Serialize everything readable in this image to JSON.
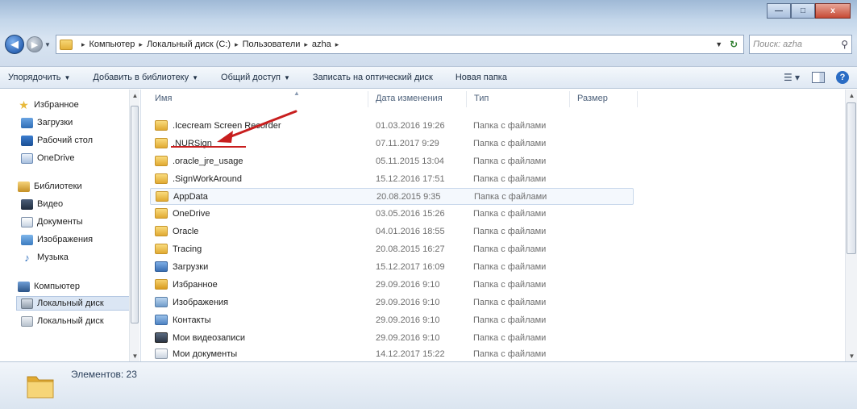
{
  "window": {
    "buttons": {
      "minimize": "—",
      "maximize": "□",
      "close": "x"
    }
  },
  "address_bar": {
    "crumbs": [
      "Компьютер",
      "Локальный диск (C:)",
      "Пользователи",
      "azha"
    ],
    "separator": "▸"
  },
  "search": {
    "placeholder": "Поиск: azha"
  },
  "toolbar": {
    "organize": "Упорядочить",
    "add_to_library": "Добавить в библиотеку",
    "share": "Общий доступ",
    "burn": "Записать на оптический диск",
    "new_folder": "Новая папка"
  },
  "navigation": {
    "favorites": "Избранное",
    "downloads": "Загрузки",
    "desktop": "Рабочий стол",
    "onedrive": "OneDrive",
    "libraries": "Библиотеки",
    "video": "Видео",
    "documents": "Документы",
    "images": "Изображения",
    "music": "Музыка",
    "computer": "Компьютер",
    "local_disk_1": "Локальный диск",
    "local_disk_2": "Локальный диск"
  },
  "columns": {
    "name": "Имя",
    "date": "Дата изменения",
    "type": "Тип",
    "size": "Размер"
  },
  "files": [
    {
      "name": ".Icecream Screen Recorder",
      "date": "01.03.2016 19:26",
      "type": "Папка с файлами",
      "icon": "folder-icon"
    },
    {
      "name": ".NURSign",
      "date": "07.11.2017 9:29",
      "type": "Папка с файлами",
      "icon": "folder-icon"
    },
    {
      "name": ".oracle_jre_usage",
      "date": "05.11.2015 13:04",
      "type": "Папка с файлами",
      "icon": "folder-icon"
    },
    {
      "name": ".SignWorkAround",
      "date": "15.12.2016 17:51",
      "type": "Папка с файлами",
      "icon": "folder-icon"
    },
    {
      "name": "AppData",
      "date": "20.08.2015 9:35",
      "type": "Папка с файлами",
      "icon": "folder-icon"
    },
    {
      "name": "OneDrive",
      "date": "03.05.2016 15:26",
      "type": "Папка с файлами",
      "icon": "folder-icon"
    },
    {
      "name": "Oracle",
      "date": "04.01.2016 18:55",
      "type": "Папка с файлами",
      "icon": "folder-icon"
    },
    {
      "name": "Tracing",
      "date": "20.08.2015 16:27",
      "type": "Папка с файлами",
      "icon": "folder-icon"
    },
    {
      "name": "Загрузки",
      "date": "15.12.2017 16:09",
      "type": "Папка с файлами",
      "icon": "downloads-folder-icon"
    },
    {
      "name": "Избранное",
      "date": "29.09.2016 9:10",
      "type": "Папка с файлами",
      "icon": "favorites-folder-icon"
    },
    {
      "name": "Изображения",
      "date": "29.09.2016 9:10",
      "type": "Папка с файлами",
      "icon": "pictures-folder-icon"
    },
    {
      "name": "Контакты",
      "date": "29.09.2016 9:10",
      "type": "Папка с файлами",
      "icon": "contacts-folder-icon"
    },
    {
      "name": "Мои видеозаписи",
      "date": "29.09.2016 9:10",
      "type": "Папка с файлами",
      "icon": "videos-folder-icon"
    },
    {
      "name": "Мои документы",
      "date": "14.12.2017 15:22",
      "type": "Папка с файлами",
      "icon": "documents-folder-icon"
    }
  ],
  "status": {
    "items_count": "Элементов: 23"
  },
  "colors": {
    "annotation_red": "#c81e1e",
    "folder_yellow": "#e1aa32",
    "accent_blue": "#2a6cc4"
  }
}
